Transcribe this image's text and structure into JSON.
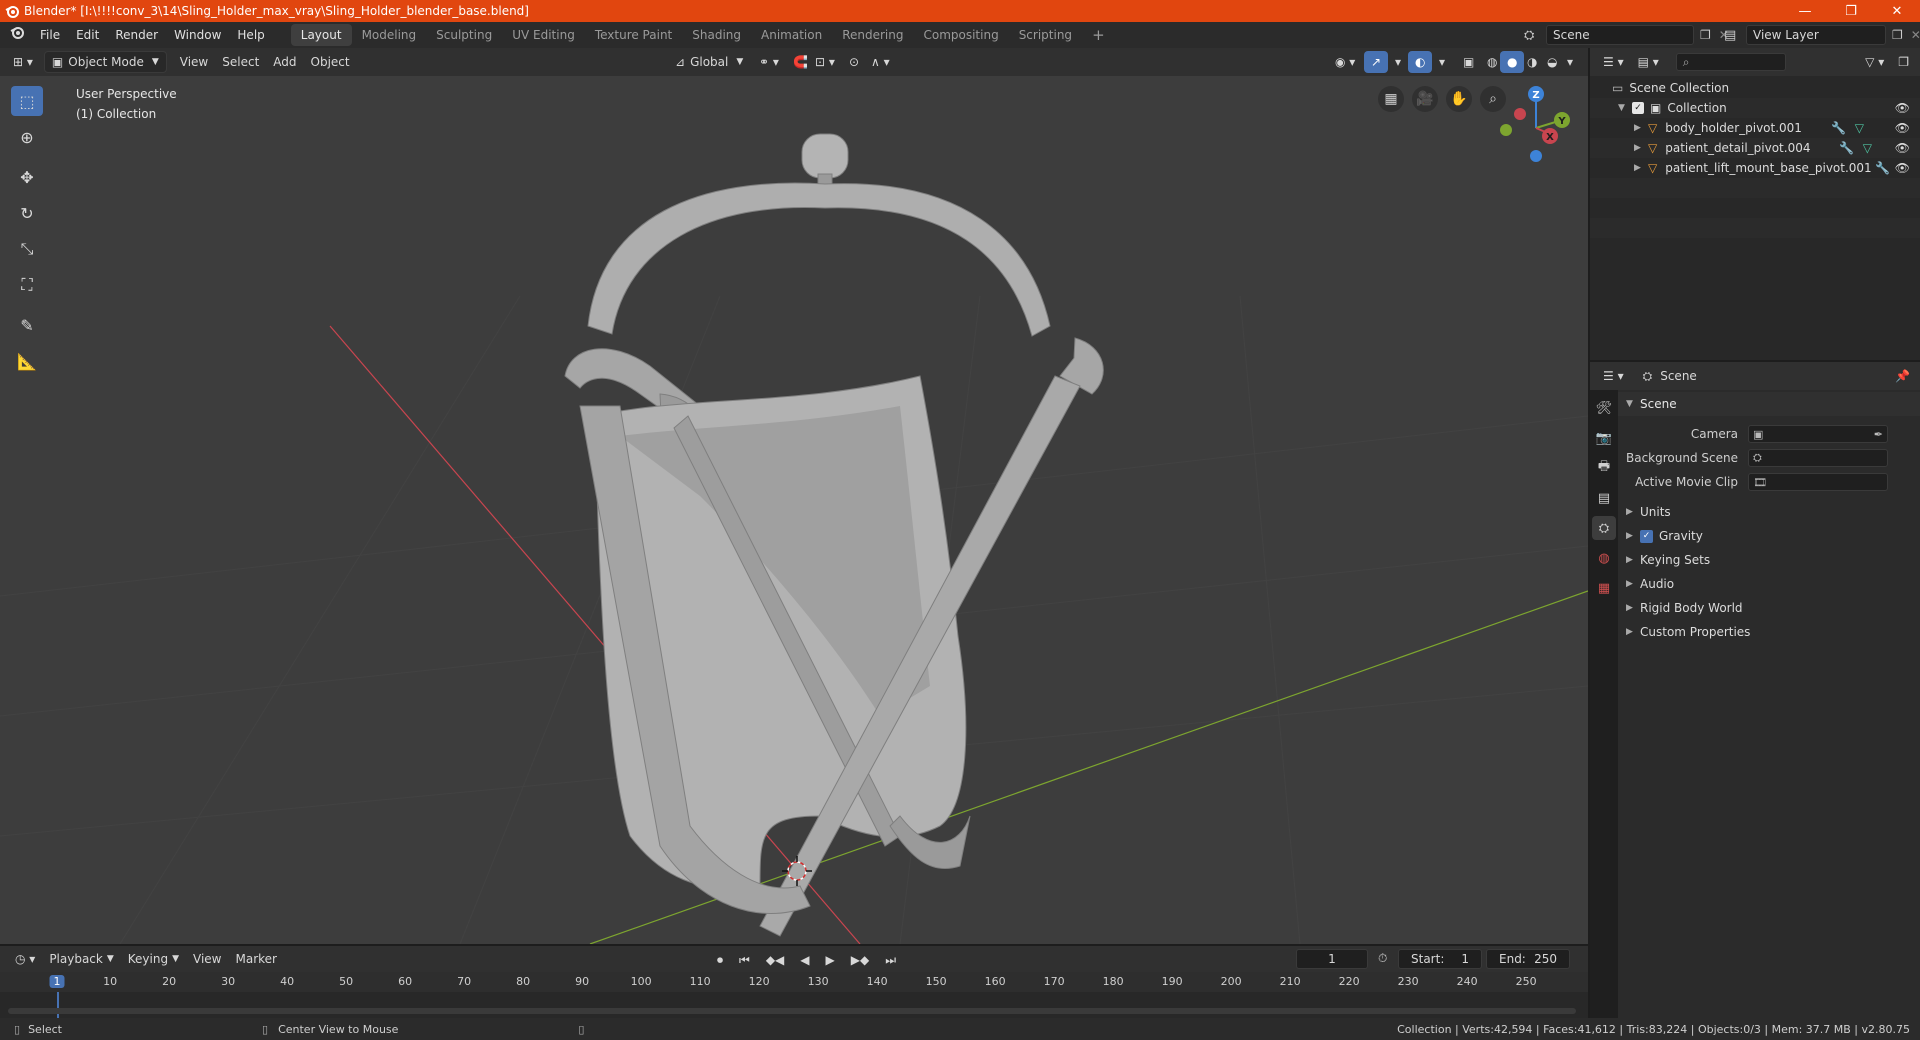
{
  "window": {
    "title": "Blender* [I:\\!!!!conv_3\\14\\Sling_Holder_max_vray\\Sling_Holder_blender_base.blend]",
    "controls": [
      "—",
      "❐",
      "✕"
    ]
  },
  "menu": [
    "File",
    "Edit",
    "Render",
    "Window",
    "Help"
  ],
  "workspaces": [
    "Layout",
    "Modeling",
    "Sculpting",
    "UV Editing",
    "Texture Paint",
    "Shading",
    "Animation",
    "Rendering",
    "Compositing",
    "Scripting"
  ],
  "active_workspace": "Layout",
  "scene_selector": "Scene",
  "view_layer_selector": "View Layer",
  "viewport_header": {
    "mode": "Object Mode",
    "menus": [
      "View",
      "Select",
      "Add",
      "Object"
    ],
    "orientation": "Global"
  },
  "viewport": {
    "perspective_label": "User Perspective",
    "collection_label": "(1) Collection",
    "gizmo_axes": [
      "Z",
      "Y",
      "X"
    ]
  },
  "outliner": {
    "root": "Scene Collection",
    "collection": "Collection",
    "objects": [
      "body_holder_pivot.001",
      "patient_detail_pivot.004",
      "patient_lift_mount_base_pivot.001"
    ]
  },
  "properties": {
    "header": "Scene",
    "panel": "Scene",
    "fields": [
      {
        "label": "Camera",
        "value": ""
      },
      {
        "label": "Background Scene",
        "value": ""
      },
      {
        "label": "Active Movie Clip",
        "value": ""
      }
    ],
    "subpanels": [
      "Units",
      "Gravity",
      "Keying Sets",
      "Audio",
      "Rigid Body World",
      "Custom Properties"
    ],
    "gravity_checked": true
  },
  "timeline": {
    "menus": [
      "Playback",
      "Keying",
      "View",
      "Marker"
    ],
    "current_frame": "1",
    "start_label": "Start:",
    "start": "1",
    "end_label": "End:",
    "end": "250",
    "ruler": [
      "1",
      "10",
      "20",
      "30",
      "40",
      "50",
      "60",
      "70",
      "80",
      "90",
      "100",
      "110",
      "120",
      "130",
      "140",
      "150",
      "160",
      "170",
      "180",
      "190",
      "200",
      "210",
      "220",
      "230",
      "240",
      "250"
    ]
  },
  "statusbar": {
    "select": "Select",
    "center_view": "Center View to Mouse",
    "stats": "Collection | Verts:42,594 | Faces:41,612 | Tris:83,224 | Objects:0/3 | Mem: 37.7 MB | v2.80.75"
  },
  "colors": {
    "title_bar": "#e1460f",
    "accent": "#4772b3",
    "viewport_bg": "#3d3d3d",
    "x_axis": "#c8454f",
    "y_axis": "#7da52f",
    "z_axis": "#3d83d8"
  }
}
